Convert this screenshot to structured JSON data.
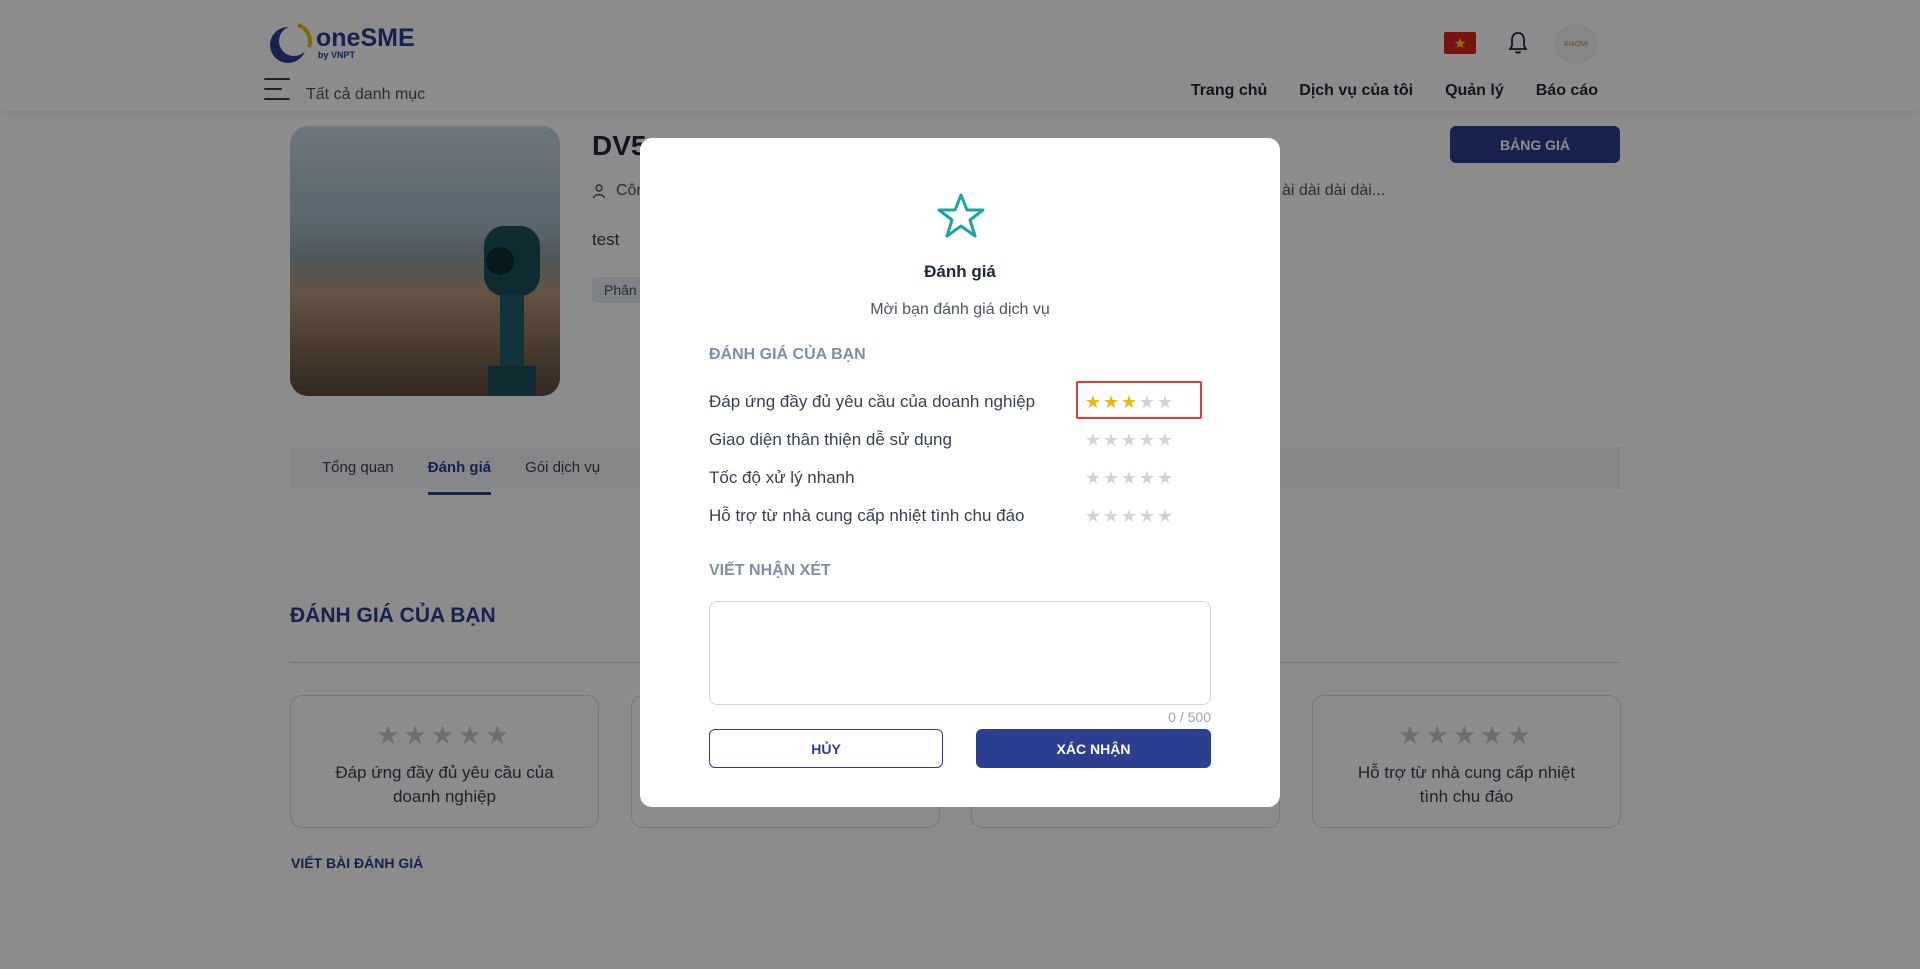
{
  "header": {
    "logo_brand": "oneSME",
    "logo_sub": "by VNPT",
    "all_categories": "Tất cả danh mục",
    "nav": [
      "Trang chủ",
      "Dịch vụ của tôi",
      "Quản lý",
      "Báo cáo"
    ],
    "avatar_text": "XIAOMI"
  },
  "service": {
    "title": "DV5",
    "provider_prefix": "Côn",
    "description_tail": "ài dài dài dài...",
    "short_desc": "test",
    "category_tag": "Phân",
    "price_button": "BẢNG GIÁ"
  },
  "tabs": [
    {
      "label": "Tổng quan",
      "active": false
    },
    {
      "label": "Đánh giá",
      "active": true
    },
    {
      "label": "Gói dịch vụ",
      "active": false
    }
  ],
  "review_section": {
    "title": "ĐÁNH GIÁ CỦA BẠN",
    "cards": [
      {
        "label": "Đáp ứng đầy đủ yêu cầu của doanh nghiệp",
        "rating": 0
      },
      {
        "label": "",
        "rating": 0
      },
      {
        "label": "",
        "rating": 0
      },
      {
        "label": "Hỗ trợ từ nhà cung cấp nhiệt tình chu đáo",
        "rating": 0
      }
    ],
    "write_review": "VIẾT BÀI ĐÁNH GIÁ"
  },
  "modal": {
    "title": "Đánh giá",
    "subtitle": "Mời bạn đánh giá dịch vụ",
    "rating_heading": "ĐÁNH GIÁ CỦA BẠN",
    "criteria": [
      {
        "label": "Đáp ứng đầy đủ yêu cầu của doanh nghiệp",
        "rating": 3,
        "highlighted": true
      },
      {
        "label": "Giao diện thân thiện dễ sử dụng",
        "rating": 0,
        "highlighted": false
      },
      {
        "label": "Tốc độ xử lý nhanh",
        "rating": 0,
        "highlighted": false
      },
      {
        "label": "Hỗ trợ từ nhà cung cấp nhiệt tình chu đáo",
        "rating": 0,
        "highlighted": false
      }
    ],
    "comment_heading": "VIẾT NHẬN XÉT",
    "comment_value": "",
    "counter": "0 / 500",
    "cancel_label": "HỦY",
    "confirm_label": "XÁC NHẬN"
  },
  "colors": {
    "primary": "#2c3e8f",
    "star_on": "#f2b705",
    "star_off": "#d0d4da",
    "modal_icon": "#1fa3a0",
    "highlight": "#e53935"
  },
  "icons": [
    "user-icon",
    "bell-icon",
    "menu-icon",
    "star-outline-icon",
    "vietnam-flag-icon"
  ]
}
